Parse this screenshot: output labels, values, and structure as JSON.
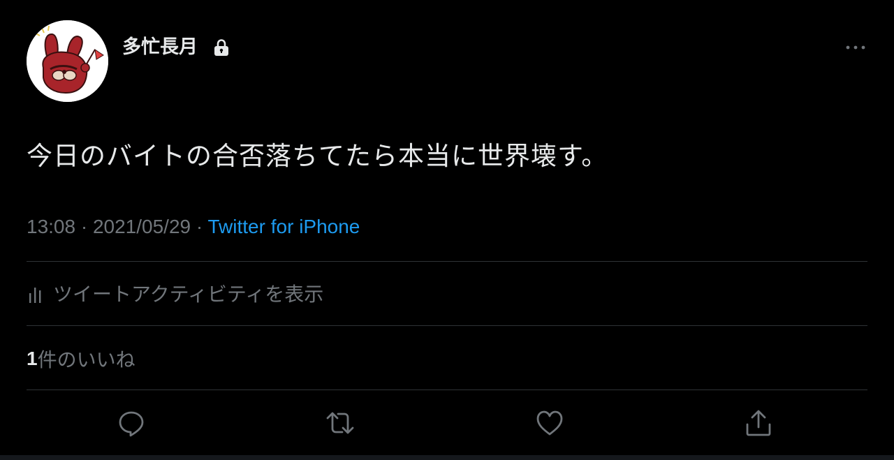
{
  "user": {
    "display_name": "多忙長月",
    "protected_icon": "lock-icon",
    "avatar_icon": "red-rabbit-character-avatar"
  },
  "tweet": {
    "text": "今日のバイトの合否落ちてたら本当に世界壊す。",
    "time": "13:08",
    "separator": "·",
    "date": "2021/05/29",
    "source": "Twitter for iPhone"
  },
  "activity": {
    "icon": "stats-icon",
    "label": "ツイートアクティビティを表示"
  },
  "likes": {
    "count": "1",
    "label": "件のいいね"
  },
  "actions": {
    "reply_icon": "reply-icon",
    "retweet_icon": "retweet-icon",
    "like_icon": "heart-icon",
    "share_icon": "share-icon",
    "more_icon": "more-icon"
  },
  "colors": {
    "background": "#000000",
    "text_primary": "#e7e9ea",
    "text_secondary": "#71767b",
    "accent": "#1d9bf0",
    "divider": "#2f3336"
  }
}
